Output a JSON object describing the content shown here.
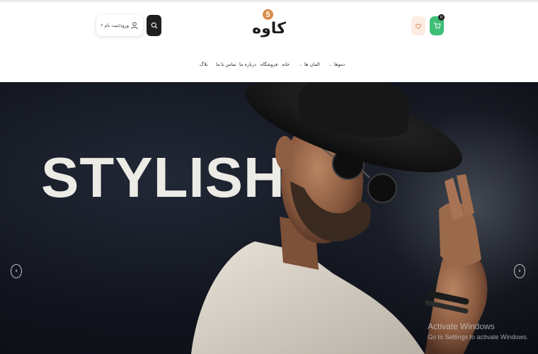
{
  "header": {
    "login_label": "ورود/ثبت نام",
    "logo_badge": "5",
    "logo_text": "کاوه",
    "cart_count": "0"
  },
  "nav": {
    "items": [
      {
        "label": "دموها",
        "has_dropdown": true
      },
      {
        "label": "المان ها",
        "has_dropdown": true
      },
      {
        "label": "خانه",
        "has_dropdown": false
      },
      {
        "label": "فروشگاه",
        "has_dropdown": false
      },
      {
        "label": "درباره ما",
        "has_dropdown": false
      },
      {
        "label": "تماس با ما",
        "has_dropdown": false
      },
      {
        "label": "بلاگ",
        "has_dropdown": false
      }
    ]
  },
  "hero": {
    "headline": "STYLISH"
  },
  "icons": {
    "search": "search-icon",
    "user": "user-icon",
    "wishlist": "heart-icon",
    "cart": "cart-icon",
    "prev": "chevron-left-icon",
    "next": "chevron-right-icon"
  },
  "colors": {
    "accent_green": "#3fbf76",
    "accent_orange": "#d98d4b",
    "wishlist_bg": "#fdece3",
    "search_bg": "#1f1f1f"
  },
  "watermark": {
    "line1": "Activate Windows",
    "line2": "Go to Settings to activate Windows."
  }
}
